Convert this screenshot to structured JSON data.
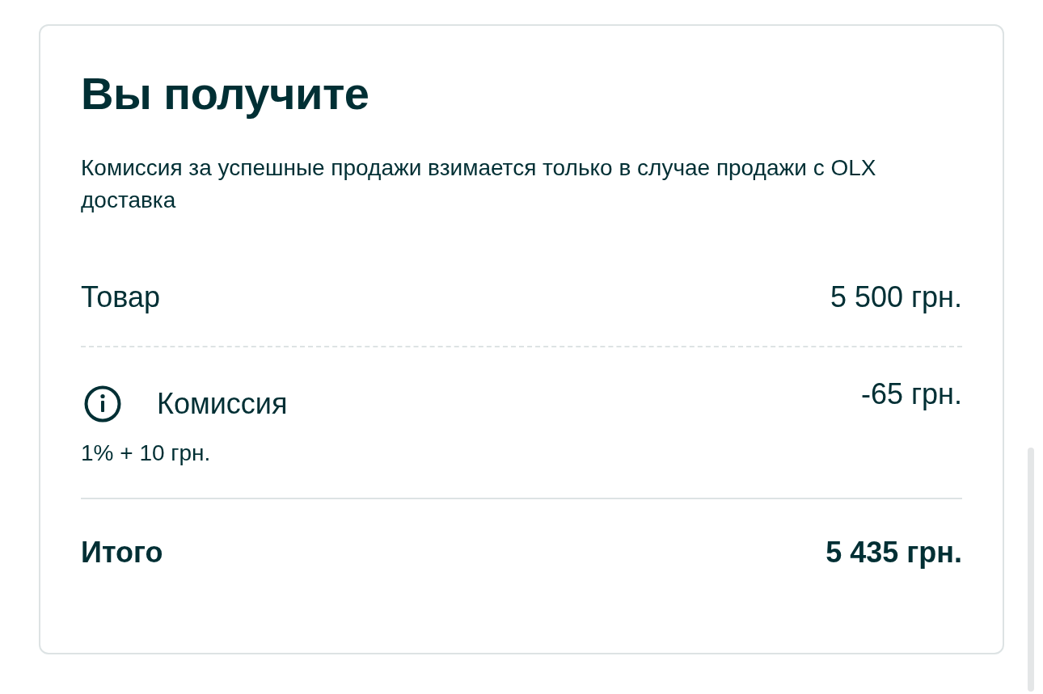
{
  "title": "Вы получите",
  "description": "Комиссия за успешные продажи взимается только в случае продажи с OLX доставка",
  "rows": [
    {
      "kind": "item",
      "label": "Товар",
      "value": "5 500 грн."
    },
    {
      "kind": "fee",
      "label": "Комиссия",
      "value": "-65 грн.",
      "note": "1% + 10 грн."
    }
  ],
  "total": {
    "label": "Итого",
    "value": "5 435 грн."
  }
}
